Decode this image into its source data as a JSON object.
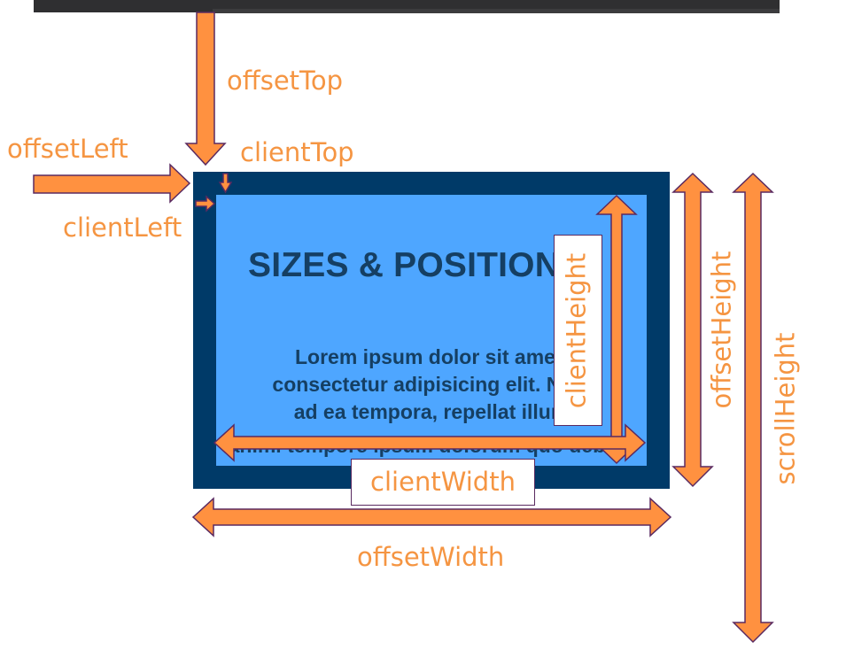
{
  "content": {
    "heading": "SIZES & POSITIONS",
    "paragraph": [
      "Lorem ipsum dolor sit amet,",
      "consectetur adipisicing elit. Nihil",
      "ad ea tempora, repellat illum",
      "animi tempore ipsum dolorum quo debitis"
    ]
  },
  "labels": {
    "offset_top": "offsetTop",
    "offset_left": "offsetLeft",
    "client_top": "clientTop",
    "client_left": "clientLeft",
    "client_height": "clientHeight",
    "offset_height": "offsetHeight",
    "scroll_height": "scrollHeight",
    "client_width": "clientWidth",
    "offset_width": "offsetWidth"
  },
  "colors": {
    "arrow_fill": "#ff9140",
    "arrow_stroke": "#5a2a60",
    "label_text": "#f59542",
    "outer_box": "#003a68",
    "inner_box": "#4ea6ff",
    "content_text": "#153f63",
    "top_bar": "#2f2f31"
  }
}
